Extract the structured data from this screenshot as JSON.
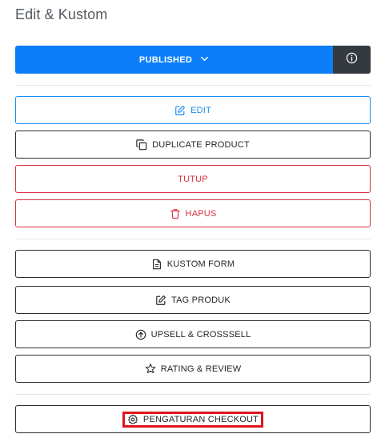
{
  "header": {
    "title": "Edit & Kustom"
  },
  "status": {
    "label": "PUBLISHED",
    "color": "#0d7ef9"
  },
  "info_button": {
    "icon": "info-icon",
    "color": "#343a40"
  },
  "actions_primary": [
    {
      "label": "EDIT",
      "icon": "edit-icon",
      "style": "primary"
    },
    {
      "label": "DUPLICATE PRODUCT",
      "icon": "copy-icon",
      "style": "default"
    },
    {
      "label": "TUTUP",
      "icon": "",
      "style": "danger"
    },
    {
      "label": "HAPUS",
      "icon": "trash-icon",
      "style": "danger"
    }
  ],
  "actions_custom": [
    {
      "label": "KUSTOM FORM",
      "icon": "document-icon"
    },
    {
      "label": "TAG PRODUK",
      "icon": "edit-icon"
    },
    {
      "label": "UPSELL & CROSSSELL",
      "icon": "arrow-up-circle-icon"
    },
    {
      "label": "RATING & REVIEW",
      "icon": "star-icon"
    }
  ],
  "actions_checkout": [
    {
      "label": "PENGATURAN CHECKOUT",
      "icon": "gear-icon",
      "highlighted": true
    }
  ],
  "colors": {
    "primary": "#1a8cf0",
    "danger": "#d6323f",
    "highlight": "#e3141b"
  }
}
